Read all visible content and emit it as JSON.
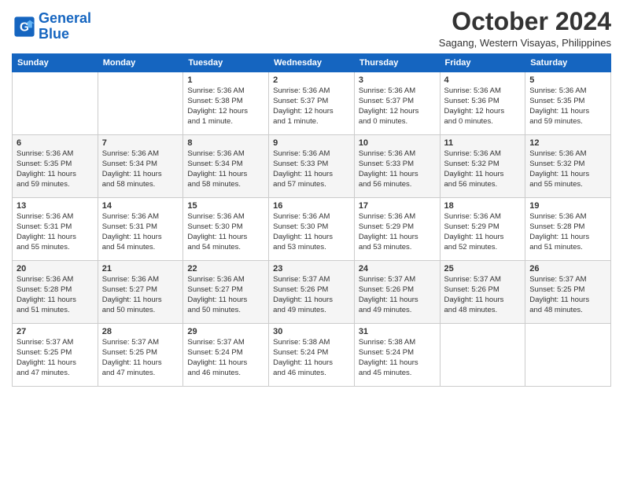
{
  "logo": {
    "line1": "General",
    "line2": "Blue"
  },
  "title": "October 2024",
  "location": "Sagang, Western Visayas, Philippines",
  "weekdays": [
    "Sunday",
    "Monday",
    "Tuesday",
    "Wednesday",
    "Thursday",
    "Friday",
    "Saturday"
  ],
  "weeks": [
    [
      {
        "day": "",
        "info": ""
      },
      {
        "day": "",
        "info": ""
      },
      {
        "day": "1",
        "info": "Sunrise: 5:36 AM\nSunset: 5:38 PM\nDaylight: 12 hours\nand 1 minute."
      },
      {
        "day": "2",
        "info": "Sunrise: 5:36 AM\nSunset: 5:37 PM\nDaylight: 12 hours\nand 1 minute."
      },
      {
        "day": "3",
        "info": "Sunrise: 5:36 AM\nSunset: 5:37 PM\nDaylight: 12 hours\nand 0 minutes."
      },
      {
        "day": "4",
        "info": "Sunrise: 5:36 AM\nSunset: 5:36 PM\nDaylight: 12 hours\nand 0 minutes."
      },
      {
        "day": "5",
        "info": "Sunrise: 5:36 AM\nSunset: 5:35 PM\nDaylight: 11 hours\nand 59 minutes."
      }
    ],
    [
      {
        "day": "6",
        "info": "Sunrise: 5:36 AM\nSunset: 5:35 PM\nDaylight: 11 hours\nand 59 minutes."
      },
      {
        "day": "7",
        "info": "Sunrise: 5:36 AM\nSunset: 5:34 PM\nDaylight: 11 hours\nand 58 minutes."
      },
      {
        "day": "8",
        "info": "Sunrise: 5:36 AM\nSunset: 5:34 PM\nDaylight: 11 hours\nand 58 minutes."
      },
      {
        "day": "9",
        "info": "Sunrise: 5:36 AM\nSunset: 5:33 PM\nDaylight: 11 hours\nand 57 minutes."
      },
      {
        "day": "10",
        "info": "Sunrise: 5:36 AM\nSunset: 5:33 PM\nDaylight: 11 hours\nand 56 minutes."
      },
      {
        "day": "11",
        "info": "Sunrise: 5:36 AM\nSunset: 5:32 PM\nDaylight: 11 hours\nand 56 minutes."
      },
      {
        "day": "12",
        "info": "Sunrise: 5:36 AM\nSunset: 5:32 PM\nDaylight: 11 hours\nand 55 minutes."
      }
    ],
    [
      {
        "day": "13",
        "info": "Sunrise: 5:36 AM\nSunset: 5:31 PM\nDaylight: 11 hours\nand 55 minutes."
      },
      {
        "day": "14",
        "info": "Sunrise: 5:36 AM\nSunset: 5:31 PM\nDaylight: 11 hours\nand 54 minutes."
      },
      {
        "day": "15",
        "info": "Sunrise: 5:36 AM\nSunset: 5:30 PM\nDaylight: 11 hours\nand 54 minutes."
      },
      {
        "day": "16",
        "info": "Sunrise: 5:36 AM\nSunset: 5:30 PM\nDaylight: 11 hours\nand 53 minutes."
      },
      {
        "day": "17",
        "info": "Sunrise: 5:36 AM\nSunset: 5:29 PM\nDaylight: 11 hours\nand 53 minutes."
      },
      {
        "day": "18",
        "info": "Sunrise: 5:36 AM\nSunset: 5:29 PM\nDaylight: 11 hours\nand 52 minutes."
      },
      {
        "day": "19",
        "info": "Sunrise: 5:36 AM\nSunset: 5:28 PM\nDaylight: 11 hours\nand 51 minutes."
      }
    ],
    [
      {
        "day": "20",
        "info": "Sunrise: 5:36 AM\nSunset: 5:28 PM\nDaylight: 11 hours\nand 51 minutes."
      },
      {
        "day": "21",
        "info": "Sunrise: 5:36 AM\nSunset: 5:27 PM\nDaylight: 11 hours\nand 50 minutes."
      },
      {
        "day": "22",
        "info": "Sunrise: 5:36 AM\nSunset: 5:27 PM\nDaylight: 11 hours\nand 50 minutes."
      },
      {
        "day": "23",
        "info": "Sunrise: 5:37 AM\nSunset: 5:26 PM\nDaylight: 11 hours\nand 49 minutes."
      },
      {
        "day": "24",
        "info": "Sunrise: 5:37 AM\nSunset: 5:26 PM\nDaylight: 11 hours\nand 49 minutes."
      },
      {
        "day": "25",
        "info": "Sunrise: 5:37 AM\nSunset: 5:26 PM\nDaylight: 11 hours\nand 48 minutes."
      },
      {
        "day": "26",
        "info": "Sunrise: 5:37 AM\nSunset: 5:25 PM\nDaylight: 11 hours\nand 48 minutes."
      }
    ],
    [
      {
        "day": "27",
        "info": "Sunrise: 5:37 AM\nSunset: 5:25 PM\nDaylight: 11 hours\nand 47 minutes."
      },
      {
        "day": "28",
        "info": "Sunrise: 5:37 AM\nSunset: 5:25 PM\nDaylight: 11 hours\nand 47 minutes."
      },
      {
        "day": "29",
        "info": "Sunrise: 5:37 AM\nSunset: 5:24 PM\nDaylight: 11 hours\nand 46 minutes."
      },
      {
        "day": "30",
        "info": "Sunrise: 5:38 AM\nSunset: 5:24 PM\nDaylight: 11 hours\nand 46 minutes."
      },
      {
        "day": "31",
        "info": "Sunrise: 5:38 AM\nSunset: 5:24 PM\nDaylight: 11 hours\nand 45 minutes."
      },
      {
        "day": "",
        "info": ""
      },
      {
        "day": "",
        "info": ""
      }
    ]
  ]
}
